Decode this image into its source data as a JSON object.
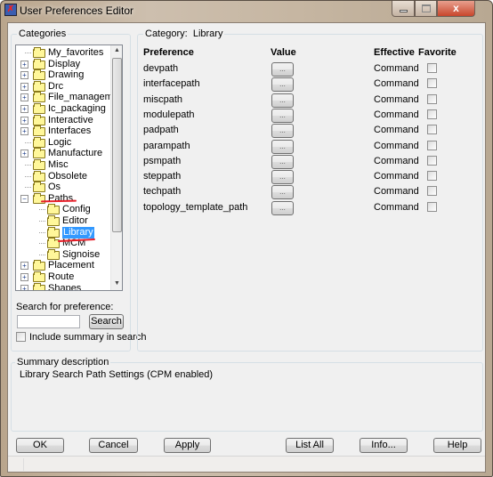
{
  "window": {
    "title": "User Preferences Editor",
    "close_label": "x"
  },
  "categories": {
    "label": "Categories",
    "tree": [
      {
        "label": "My_favorites",
        "level": 0,
        "expander": ""
      },
      {
        "label": "Display",
        "level": 0,
        "expander": "+"
      },
      {
        "label": "Drawing",
        "level": 0,
        "expander": "+"
      },
      {
        "label": "Drc",
        "level": 0,
        "expander": "+"
      },
      {
        "label": "File_management",
        "level": 0,
        "expander": "+"
      },
      {
        "label": "Ic_packaging",
        "level": 0,
        "expander": "+"
      },
      {
        "label": "Interactive",
        "level": 0,
        "expander": "+"
      },
      {
        "label": "Interfaces",
        "level": 0,
        "expander": "+"
      },
      {
        "label": "Logic",
        "level": 0,
        "expander": ""
      },
      {
        "label": "Manufacture",
        "level": 0,
        "expander": "+"
      },
      {
        "label": "Misc",
        "level": 0,
        "expander": ""
      },
      {
        "label": "Obsolete",
        "level": 0,
        "expander": ""
      },
      {
        "label": "Os",
        "level": 0,
        "expander": ""
      },
      {
        "label": "Paths",
        "level": 0,
        "expander": "-"
      },
      {
        "label": "Config",
        "level": 1,
        "expander": ""
      },
      {
        "label": "Editor",
        "level": 1,
        "expander": ""
      },
      {
        "label": "Library",
        "level": 1,
        "expander": "",
        "selected": true
      },
      {
        "label": "MCM",
        "level": 1,
        "expander": ""
      },
      {
        "label": "Signoise",
        "level": 1,
        "expander": ""
      },
      {
        "label": "Placement",
        "level": 0,
        "expander": "+"
      },
      {
        "label": "Route",
        "level": 0,
        "expander": "+"
      },
      {
        "label": "Shapes",
        "level": 0,
        "expander": "+"
      }
    ],
    "search_label": "Search for preference:",
    "search_value": "",
    "search_button": "Search",
    "include_summary_label": "Include summary in search",
    "include_summary_checked": false
  },
  "category": {
    "label": "Category:",
    "name": "Library",
    "headers": {
      "preference": "Preference",
      "value": "Value",
      "effective": "Effective",
      "favorite": "Favorite"
    },
    "rows": [
      {
        "preference": "devpath",
        "value": "...",
        "effective": "Command",
        "favorite": false
      },
      {
        "preference": "interfacepath",
        "value": "...",
        "effective": "Command",
        "favorite": false
      },
      {
        "preference": "miscpath",
        "value": "...",
        "effective": "Command",
        "favorite": false
      },
      {
        "preference": "modulepath",
        "value": "...",
        "effective": "Command",
        "favorite": false
      },
      {
        "preference": "padpath",
        "value": "...",
        "effective": "Command",
        "favorite": false
      },
      {
        "preference": "parampath",
        "value": "...",
        "effective": "Command",
        "favorite": false
      },
      {
        "preference": "psmpath",
        "value": "...",
        "effective": "Command",
        "favorite": false
      },
      {
        "preference": "steppath",
        "value": "...",
        "effective": "Command",
        "favorite": false
      },
      {
        "preference": "techpath",
        "value": "...",
        "effective": "Command",
        "favorite": false
      },
      {
        "preference": "topology_template_path",
        "value": "...",
        "effective": "Command",
        "favorite": false
      }
    ]
  },
  "summary": {
    "label": "Summary description",
    "text": "Library Search Path Settings (CPM enabled)"
  },
  "buttons": {
    "ok": "OK",
    "cancel": "Cancel",
    "apply": "Apply",
    "list_all": "List All",
    "info": "Info...",
    "help": "Help"
  },
  "colors": {
    "selection": "#3399ff",
    "annotation": "#e8202a"
  }
}
